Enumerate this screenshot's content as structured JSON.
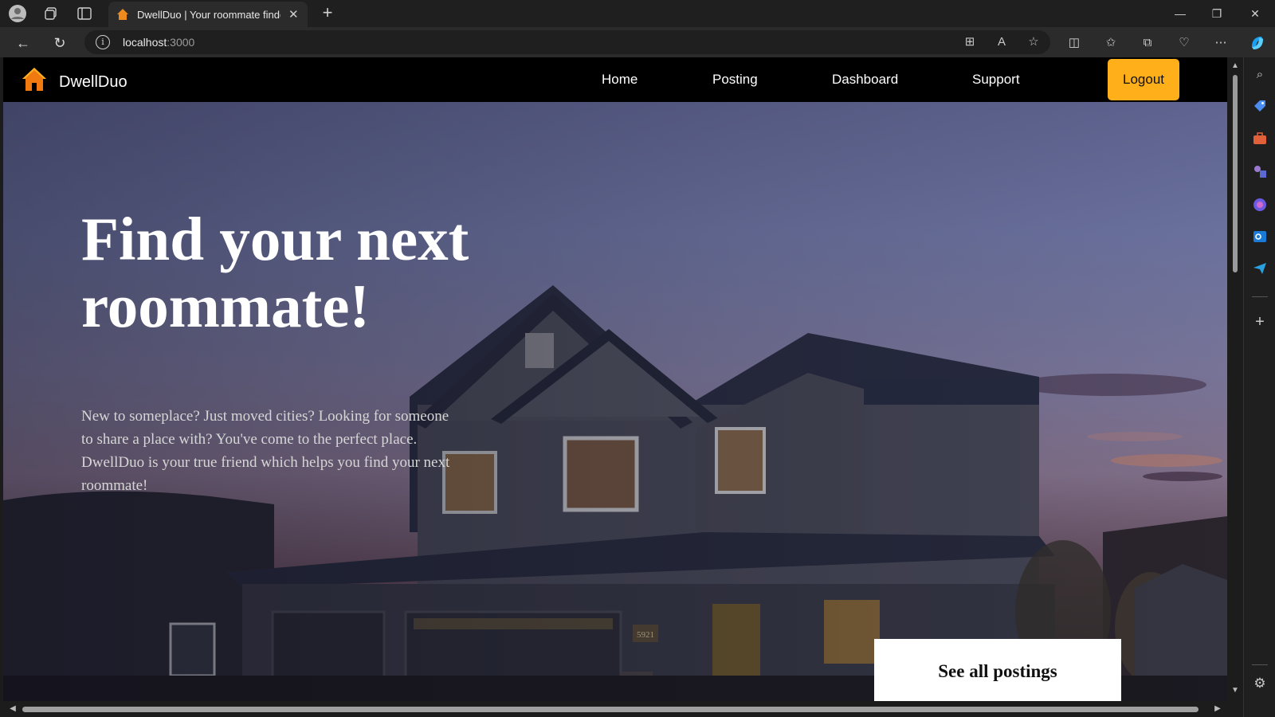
{
  "browser": {
    "tab_title": "DwellDuo | Your roommate finder",
    "new_tab_symbol": "+",
    "url_host": "localhost",
    "url_port": ":3000"
  },
  "site": {
    "brand": "DwellDuo",
    "nav": {
      "home": "Home",
      "posting": "Posting",
      "dashboard": "Dashboard",
      "support": "Support",
      "logout": "Logout"
    }
  },
  "hero": {
    "headline": "Find your next roommate!",
    "subtext": "New to someplace? Just moved cities? Looking for someone to share a place with? You've come to the perfect place. DwellDuo is your true friend which helps you find your next roommate!",
    "cta": "See all postings",
    "house_number": "5921"
  },
  "colors": {
    "accent": "#ffaf1a",
    "navbar_bg": "#000000",
    "cta_bg": "#ffffff"
  },
  "icons": {
    "logo": "house-icon",
    "sidebar": [
      "search-icon",
      "tag-icon",
      "briefcase-icon",
      "games-icon",
      "copilot-circle-icon",
      "outlook-icon",
      "send-icon",
      "add-icon",
      "settings-icon"
    ]
  }
}
